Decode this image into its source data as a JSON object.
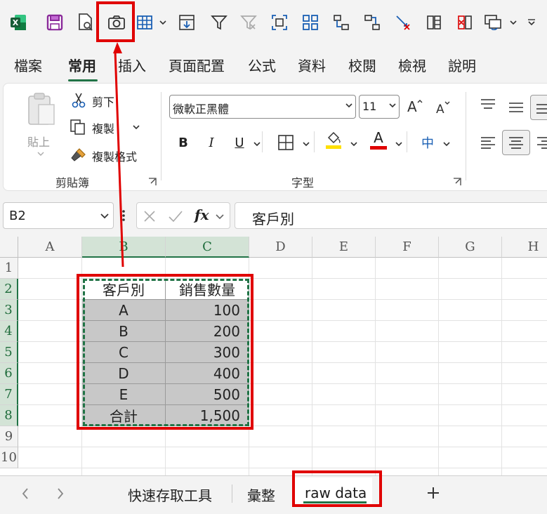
{
  "ribbon_tabs": [
    "檔案",
    "常用",
    "插入",
    "頁面配置",
    "公式",
    "資料",
    "校閱",
    "檢視",
    "說明"
  ],
  "active_tab": "常用",
  "clipboard": {
    "paste_label": "貼上",
    "cut_label": "剪下",
    "copy_label": "複製",
    "format_painter_label": "複製格式",
    "group_label": "剪貼簿"
  },
  "font": {
    "family_value": "微軟正黑體",
    "size_value": "11",
    "bold_label": "B",
    "italic_label": "I",
    "underline_label": "U",
    "font_color_glyph": "A",
    "phonetic_glyph": "中",
    "group_label": "字型"
  },
  "formula_bar": {
    "name_box": "B2",
    "fx_label": "fx",
    "formula": "客戶別"
  },
  "columns": [
    "A",
    "B",
    "C",
    "D",
    "E",
    "F",
    "G",
    "H"
  ],
  "rows": [
    "1",
    "2",
    "3",
    "4",
    "5",
    "6",
    "7",
    "8",
    "9",
    "10"
  ],
  "table": {
    "headers": [
      "客戶別",
      "銷售數量"
    ],
    "rows": [
      [
        "A",
        "100"
      ],
      [
        "B",
        "200"
      ],
      [
        "C",
        "300"
      ],
      [
        "D",
        "400"
      ],
      [
        "E",
        "500"
      ],
      [
        "合計",
        "1,500"
      ]
    ]
  },
  "sheet_tabs": [
    "快速存取工具",
    "彙整",
    "raw data"
  ],
  "active_sheet": "raw data",
  "colors": {
    "excel_green": "#217346",
    "annotation_red": "#e00000",
    "data_fill": "#c8c8c8"
  }
}
